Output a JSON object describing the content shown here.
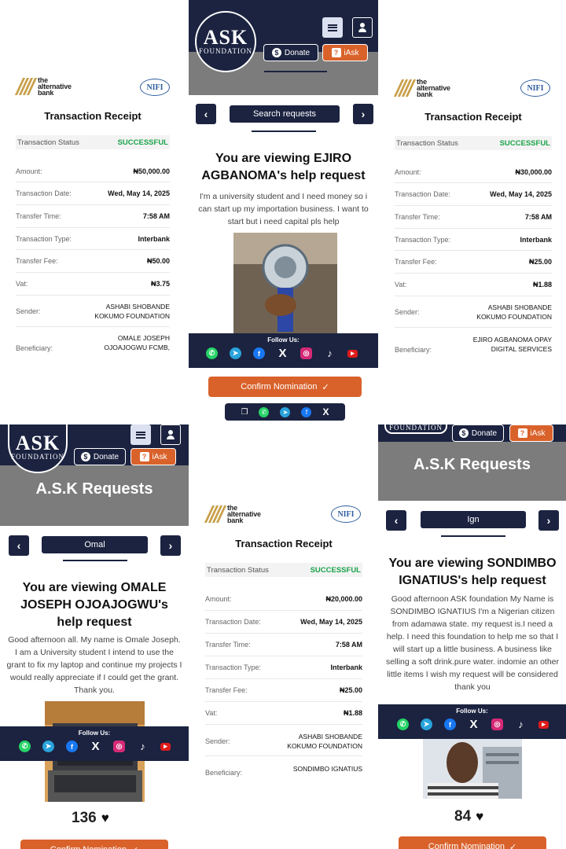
{
  "colors": {
    "navy": "#1b2340",
    "orange": "#d9622b",
    "success_green": "#1ba34a",
    "banner_gray": "#7c7c7c"
  },
  "icons": [
    "donate-dollar-icon",
    "iask-question-icon",
    "hamburger-menu-icon",
    "user-icon",
    "chevron-left-icon",
    "chevron-right-icon",
    "check-icon",
    "heart-icon",
    "copy-icon",
    "whatsapp-icon",
    "telegram-icon",
    "facebook-icon",
    "x-icon",
    "instagram-icon",
    "tiktok-icon",
    "youtube-icon"
  ],
  "receipt_common": {
    "logo_text": "the alternative bank",
    "nifi": "NIFI",
    "title": "Transaction Receipt",
    "status_label": "Transaction Status",
    "status_value": "SUCCESSFUL",
    "labels": {
      "amount": "Amount:",
      "date": "Transaction Date:",
      "time": "Transfer Time:",
      "type": "Transaction Type:",
      "fee": "Transfer Fee:",
      "vat": "Vat:",
      "sender": "Sender:",
      "beneficiary": "Beneficiary:"
    }
  },
  "receipts": [
    {
      "amount": "₦50,000.00",
      "date": "Wed, May 14, 2025",
      "time": "7:58 AM",
      "type": "Interbank",
      "fee": "₦50.00",
      "vat": "₦3.75",
      "sender_line1": "ASHABI SHOBANDE",
      "sender_line2": "KOKUMO FOUNDATION",
      "beneficiary_line1": "OMALE JOSEPH",
      "beneficiary_line2": "OJOAJOGWU FCMB,"
    },
    {
      "amount": "₦30,000.00",
      "date": "Wed, May 14, 2025",
      "time": "7:58 AM",
      "type": "Interbank",
      "fee": "₦25.00",
      "vat": "₦1.88",
      "sender_line1": "ASHABI SHOBANDE",
      "sender_line2": "KOKUMO FOUNDATION",
      "beneficiary_line1": "EJIRO  AGBANOMA OPAY",
      "beneficiary_line2": "DIGITAL SERVICES"
    },
    {
      "amount": "₦20,000.00",
      "date": "Wed, May 14, 2025",
      "time": "7:58 AM",
      "type": "Interbank",
      "fee": "₦25.00",
      "vat": "₦1.88",
      "sender_line1": "ASHABI SHOBANDE",
      "sender_line2": "KOKUMO FOUNDATION",
      "beneficiary_line1": "SONDIMBO  IGNATIUS",
      "beneficiary_line2": ""
    }
  ],
  "ask_common": {
    "logo_big": "ASK",
    "logo_small": "FOUNDATION",
    "donate_label": "Donate",
    "iask_label": "iAsk",
    "site_title": "A.S.K Requests",
    "follow_label": "Follow Us:",
    "confirm_label": "Confirm Nomination"
  },
  "requests": [
    {
      "search": "Search requests",
      "title": "You are viewing EJIRO AGBANOMA's help request",
      "description": "I'm a university student and I need money so i can start up my importation business. I want to start but i need capital pls help"
    },
    {
      "search": "Omal",
      "title": "You are viewing OMALE JOSEPH OJOAJOGWU's help request",
      "description": "Good afternoon all. My name is Omale Joseph. I am a University student I intend to use the grant to fix my laptop and continue my projects I would really appreciate if I could get the grant. Thank you.",
      "count": "136"
    },
    {
      "search": "Ign",
      "title": "You are viewing SONDIMBO IGNATIUS's help request",
      "description": "Good afternoon ASK foundation My Name is SONDIMBO IGNATIUS I'm a Nigerian citizen from adamawa state. my request is.I need a help. I need this foundation to help me so that I will start up a little business. A business like selling a soft drink.pure water. indomie an other little items I wish my request will be considered thank you",
      "count": "84"
    }
  ]
}
